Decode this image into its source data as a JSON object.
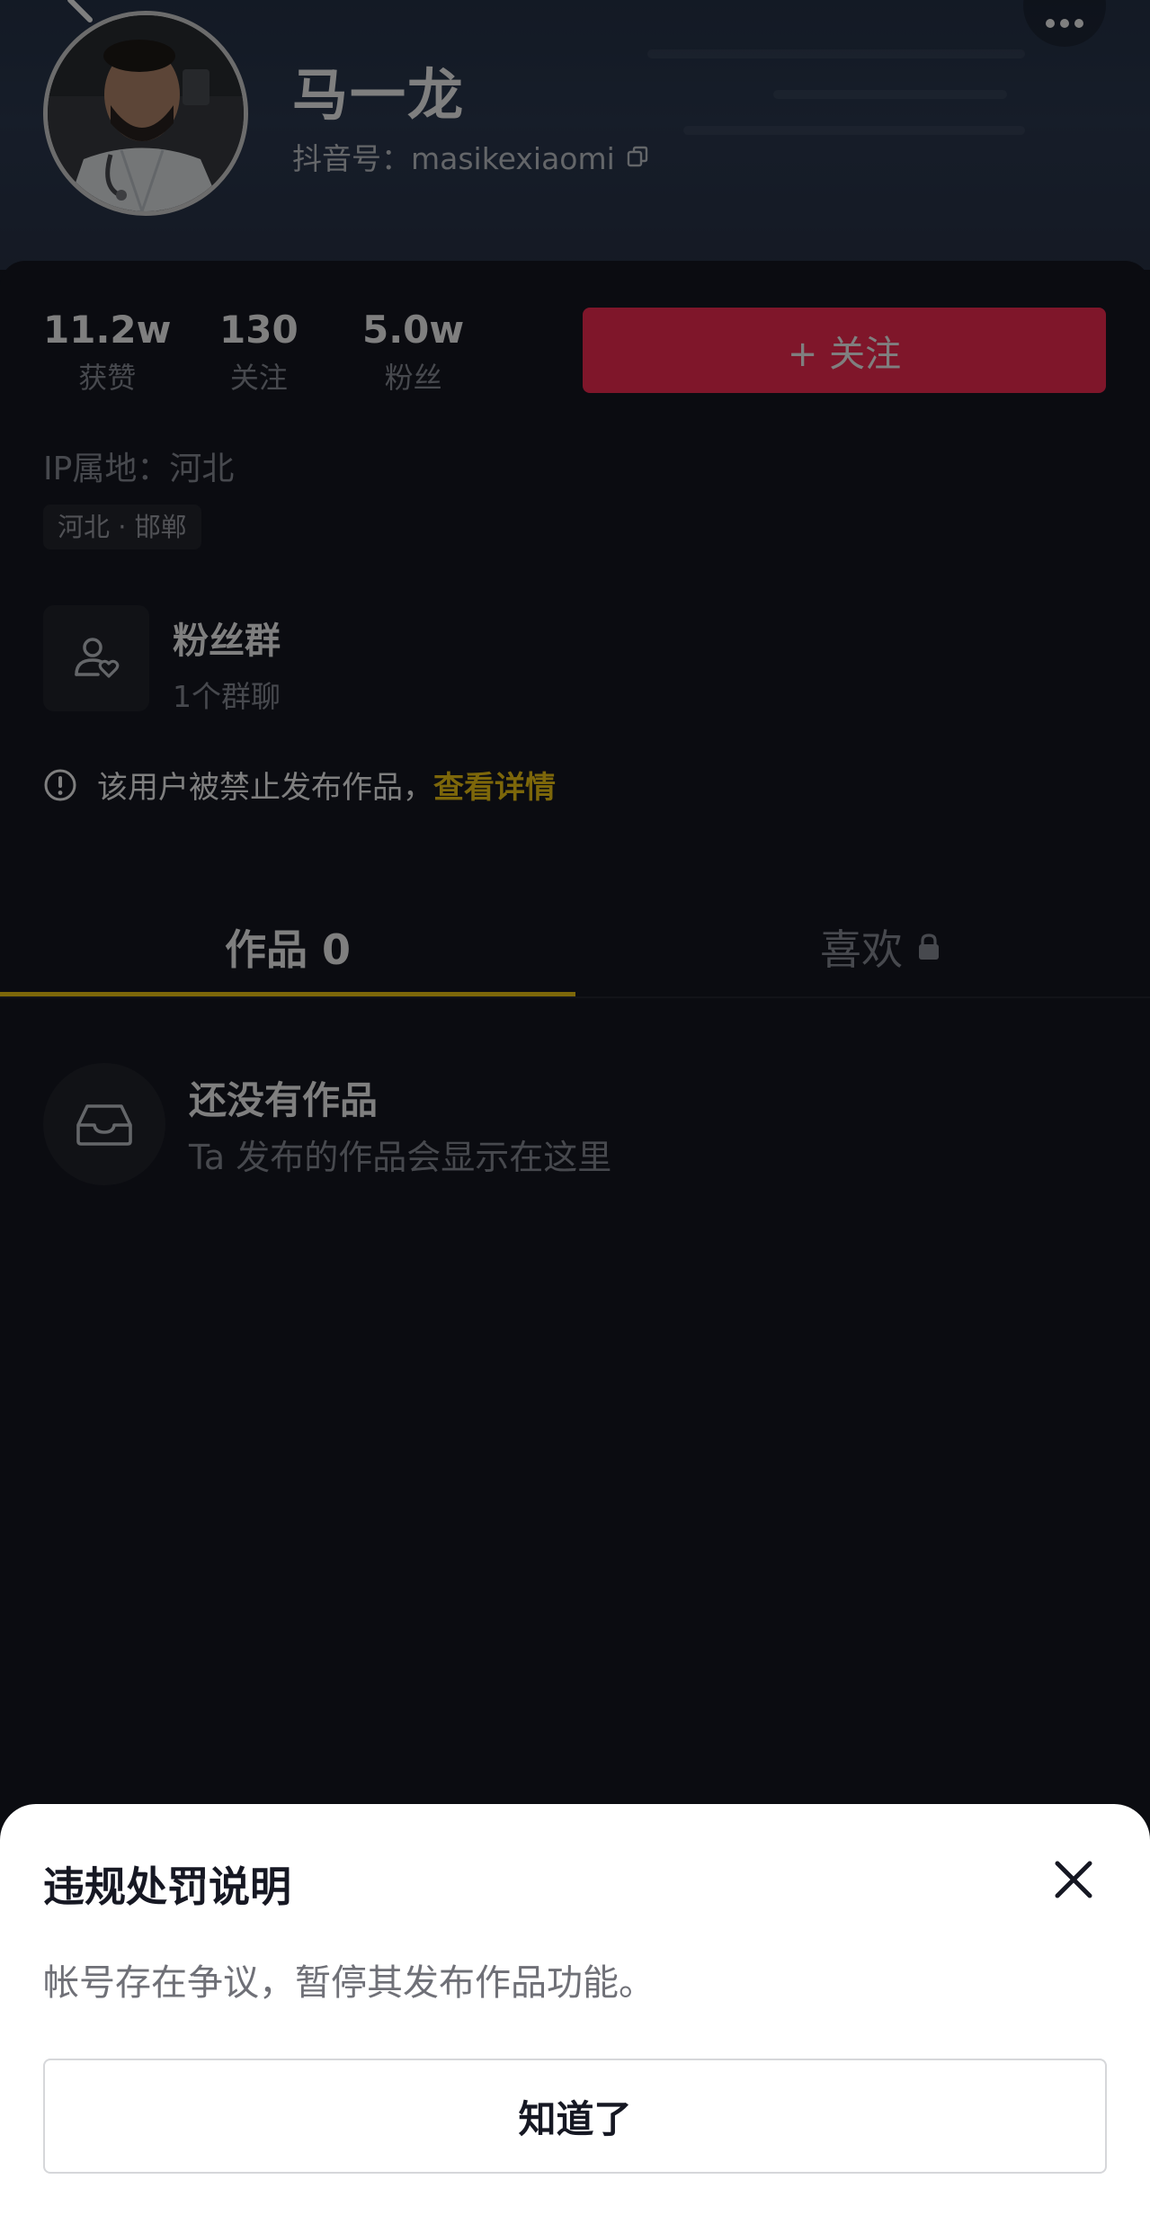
{
  "profile": {
    "name": "马一龙",
    "douyin_id": "抖音号：masikexiaomi"
  },
  "stats": [
    {
      "value": "11.2w",
      "label": "获赞"
    },
    {
      "value": "130",
      "label": "关注"
    },
    {
      "value": "5.0w",
      "label": "粉丝"
    }
  ],
  "follow_button": "+ 关注",
  "ip_location": "IP属地：河北",
  "location_tag": "河北 · 邯郸",
  "fan_group": {
    "title": "粉丝群",
    "subtitle": "1个群聊"
  },
  "ban_notice": {
    "text": "该用户被禁止发布作品，",
    "link": "查看详情"
  },
  "tabs": {
    "works": "作品 0",
    "likes": "喜欢"
  },
  "empty_state": {
    "title": "还没有作品",
    "subtitle": "Ta 发布的作品会显示在这里"
  },
  "sheet": {
    "title": "违规处罚说明",
    "body": "帐号存在争议，暂停其发布作品功能。",
    "button": "知道了"
  },
  "icons": {
    "back": "back-arrow-icon",
    "more": "more-dots-icon",
    "copy": "copy-icon",
    "fan_group": "user-heart-icon",
    "warning": "warning-circle-icon",
    "lock": "lock-icon",
    "inbox": "inbox-tray-icon",
    "close": "close-icon"
  },
  "colors": {
    "background": "#161823",
    "accent_red": "#fe2c55",
    "link_yellow": "#face15",
    "secondary_text": "#8f929c"
  }
}
